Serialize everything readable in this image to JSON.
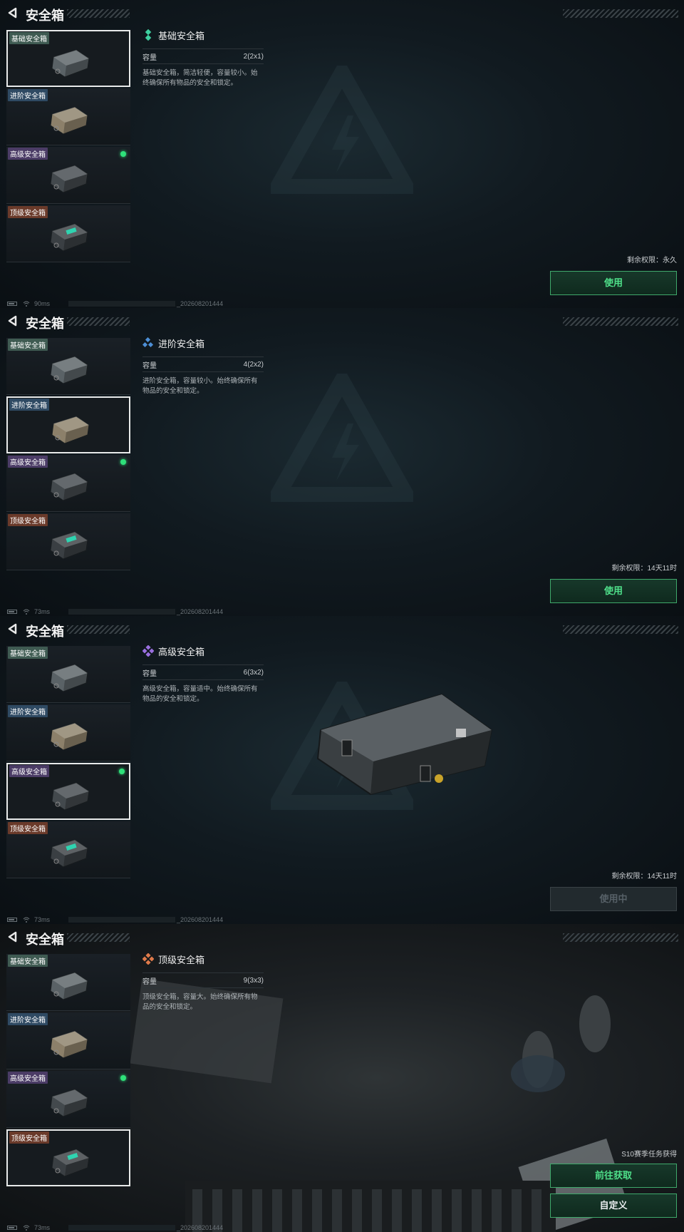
{
  "page_title": "安全箱",
  "cases": [
    {
      "label": "基础安全箱",
      "body_color": "#5a6266"
    },
    {
      "label": "进阶安全箱",
      "body_color": "#8c806a"
    },
    {
      "label": "高级安全箱",
      "body_color": "#43494d"
    },
    {
      "label": "顶级安全箱",
      "body_color": "#3a3f43"
    }
  ],
  "capacity_label": "容量",
  "panels": [
    {
      "selected": 0,
      "name": "基础安全箱",
      "rarity_color": "#3ed0a0",
      "capacity": "2(2x1)",
      "description": "基础安全箱，简洁轻便，容量较小。始终确保所有物品的安全和锁定。",
      "remain": "剩余权限：永久",
      "button": "使用",
      "ping": "90ms",
      "build": "_202608201444"
    },
    {
      "selected": 1,
      "name": "进阶安全箱",
      "rarity_color": "#4d8fd6",
      "capacity": "4(2x2)",
      "description": "进阶安全箱，容量较小。始终确保所有物品的安全和锁定。",
      "remain": "剩余权限：14天11时",
      "button": "使用",
      "ping": "73ms",
      "build": "_202608201444"
    },
    {
      "selected": 2,
      "name": "高级安全箱",
      "rarity_color": "#9a6fe0",
      "capacity": "6(3x2)",
      "description": "高级安全箱，容量适中。始终确保所有物品的安全和锁定。",
      "remain": "剩余权限：14天11时",
      "button": "使用中",
      "ping": "73ms",
      "build": "_202608201444"
    },
    {
      "selected": 3,
      "name": "顶级安全箱",
      "rarity_color": "#e07a4a",
      "capacity": "9(3x3)",
      "description": "顶级安全箱，容量大。始终确保所有物品的安全和锁定。",
      "remain": "S10赛季任务获得",
      "button": "前往获取",
      "button2": "自定义",
      "ping": "73ms",
      "build": "_202608201444"
    }
  ],
  "equipped_dot_color": "#2fe07a",
  "accent_green": "#4fe08a"
}
